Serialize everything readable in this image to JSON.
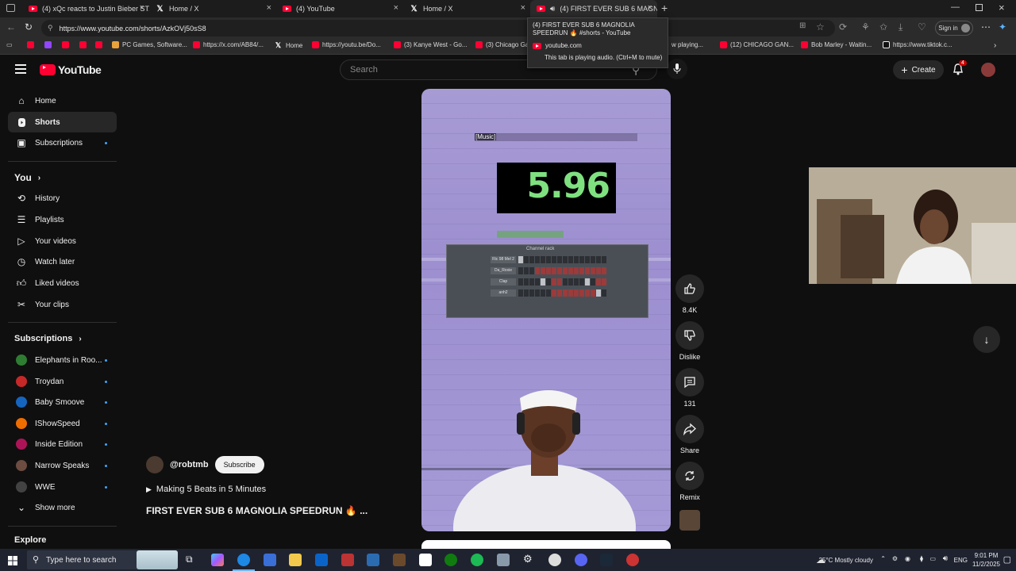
{
  "browser": {
    "tabs": [
      {
        "title": "(4) xQc reacts to Justin Bieber ST...",
        "icon": "youtube-icon"
      },
      {
        "title": "Home / X",
        "icon": "x-icon"
      },
      {
        "title": "(4) YouTube",
        "icon": "youtube-icon"
      },
      {
        "title": "Home / X",
        "icon": "x-icon"
      },
      {
        "title": "(4) FIRST EVER SUB 6 MAGNO",
        "icon": "youtube-icon"
      }
    ],
    "url": "https://www.youtube.com/shorts/AzkOVj50sS8",
    "signin_label": "Sign in",
    "bookmarks": [
      "PC Games, Software...",
      "https://x.com/AB84/...",
      "Home",
      "https://youtu.be/Do...",
      "(3) Kanye West - Go...",
      "(3) Chicago Ga",
      "w playing...",
      "(12) CHICAGO GAN...",
      "Bob Marley - Waitin...",
      "https://www.tiktok.c..."
    ],
    "tooltip": {
      "title": "(4) FIRST EVER SUB 6 MAGNOLIA SPEEDRUN 🔥 #shorts - YouTube",
      "domain": "youtube.com",
      "audio_note": "This tab is playing audio. (Ctrl+M to mute)"
    }
  },
  "youtube": {
    "logo_text": "YouTube",
    "search_placeholder": "Search",
    "create_label": "Create",
    "notif_count": "4",
    "sidebar": {
      "main": [
        {
          "label": "Home",
          "icon": "home-icon"
        },
        {
          "label": "Shorts",
          "icon": "shorts-icon"
        },
        {
          "label": "Subscriptions",
          "icon": "subscriptions-icon"
        }
      ],
      "you_heading": "You",
      "you_items": [
        {
          "label": "History",
          "icon": "history-icon"
        },
        {
          "label": "Playlists",
          "icon": "playlists-icon"
        },
        {
          "label": "Your videos",
          "icon": "your-videos-icon"
        },
        {
          "label": "Watch later",
          "icon": "watch-later-icon"
        },
        {
          "label": "Liked videos",
          "icon": "liked-videos-icon"
        },
        {
          "label": "Your clips",
          "icon": "scissors-icon"
        }
      ],
      "subs_heading": "Subscriptions",
      "subs": [
        {
          "label": "Elephants in Roo...",
          "color": "#2e7d32"
        },
        {
          "label": "Troydan",
          "color": "#c62828"
        },
        {
          "label": "Baby Smoove",
          "color": "#1565c0"
        },
        {
          "label": "IShowSpeed",
          "color": "#ef6c00"
        },
        {
          "label": "Inside Edition",
          "color": "#ad1457"
        },
        {
          "label": "Narrow Speaks",
          "color": "#6d4c41"
        },
        {
          "label": "WWE",
          "color": "#424242"
        }
      ],
      "show_more": "Show more",
      "explore_heading": "Explore"
    },
    "short": {
      "caption": "[Music]",
      "timer_value": "5.96",
      "rack_title": "Channel rack",
      "rack_rows": [
        "Ric 98 Mel 2",
        "Da_Roxie",
        "Clap",
        "anh2"
      ],
      "channel": "@robtmb",
      "subscribe_label": "Subscribe",
      "playlist_label": "Making 5 Beats in 5 Minutes",
      "title": "FIRST EVER SUB 6 MAGNOLIA SPEEDRUN 🔥 ..."
    },
    "actions": {
      "likes": "8.4K",
      "dislike": "Dislike",
      "comments": "131",
      "share": "Share",
      "remix": "Remix"
    }
  },
  "taskbar": {
    "search_placeholder": "Type here to search",
    "weather": "25°C  Mostly cloudy",
    "language": "ENG",
    "time": "9:01 PM",
    "date": "11/2/2025"
  }
}
